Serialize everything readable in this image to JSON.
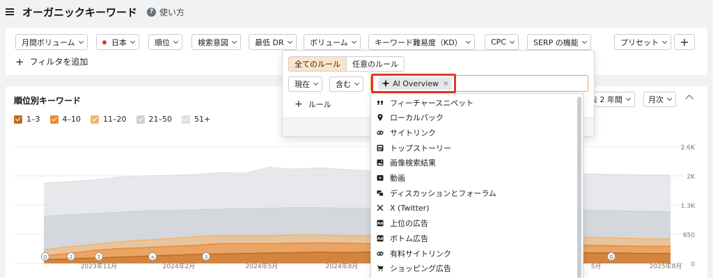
{
  "header": {
    "title": "オーガニックキーワード",
    "help_label": "使い方",
    "help_icon": "?"
  },
  "filters": {
    "buttons": [
      "月間ボリューム",
      "日本",
      "順位",
      "検索意図",
      "最低 DR",
      "ボリューム",
      "キーワード難易度（KD）",
      "CPC",
      "SERP の機能",
      "プリセット"
    ],
    "add_filter_label": "フィルタを追加",
    "plus_icon": "+"
  },
  "chart_card": {
    "title": "順位別キーワード",
    "legend": [
      {
        "label": "1–3",
        "color": "#c06c20",
        "checked": true
      },
      {
        "label": "4–10",
        "color": "#ed8a36",
        "checked": true
      },
      {
        "label": "11–20",
        "color": "#f5b46c",
        "checked": true
      },
      {
        "label": "21–50",
        "color": "#cdd1d6",
        "checked": true
      },
      {
        "label": "51+",
        "color": "#dde0e4",
        "checked": true
      }
    ],
    "period_label": "去 2 年間",
    "interval_label": "月次"
  },
  "chart_data": {
    "type": "area",
    "x_ticks": [
      "2023年11月",
      "2024年2月",
      "2024年5月",
      "2024年8月",
      "5月",
      "2025年8月"
    ],
    "y_ticks": [
      "2.6K",
      "2K",
      "1.3K",
      "650",
      "0"
    ],
    "ylim": [
      0,
      2600
    ],
    "grid": true,
    "series": [
      {
        "name": "1–3",
        "color": "#c06c20",
        "values": [
          80,
          100,
          120,
          140,
          160,
          180,
          200,
          210,
          220,
          230,
          240,
          250,
          240,
          250,
          250,
          260,
          260,
          260,
          260,
          250,
          240,
          240,
          230,
          230,
          220,
          220
        ]
      },
      {
        "name": "4–10",
        "color": "#ed8a36",
        "values": [
          170,
          220,
          290,
          330,
          350,
          380,
          400,
          440,
          440,
          440,
          450,
          460,
          450,
          440,
          440,
          440,
          450,
          450,
          440,
          430,
          420,
          410,
          400,
          390,
          380,
          380
        ]
      },
      {
        "name": "11–20",
        "color": "#f5b46c",
        "values": [
          300,
          370,
          420,
          480,
          520,
          550,
          590,
          620,
          620,
          620,
          630,
          630,
          620,
          620,
          630,
          620,
          630,
          620,
          620,
          610,
          600,
          590,
          580,
          560,
          550,
          540
        ]
      },
      {
        "name": "21–50",
        "color": "#cdd1d6",
        "values": [
          1050,
          1080,
          1110,
          1140,
          1170,
          1180,
          1190,
          1210,
          1220,
          1230,
          1240,
          1240,
          1230,
          1230,
          1240,
          1230,
          1240,
          1230,
          1230,
          1220,
          1200,
          1190,
          1180,
          1170,
          1160,
          1150
        ]
      },
      {
        "name": "51+",
        "color": "#dde0e4",
        "values": [
          1790,
          1820,
          1860,
          1920,
          1950,
          1960,
          1980,
          2020,
          2010,
          2140,
          2100,
          2130,
          2090,
          2060,
          2050,
          2030,
          2030,
          2010,
          1990,
          1980,
          1980,
          1990,
          1990,
          1980,
          1970,
          1970
        ]
      }
    ],
    "annotations": [
      "G",
      "2",
      "2",
      "a",
      "3",
      "G"
    ]
  },
  "popover": {
    "segment": [
      "全てのルール",
      "任意のルール"
    ],
    "condition_labels": [
      "現在",
      "含む"
    ],
    "tag_label": "AI Overview",
    "tag_close": "×",
    "add_rule_label": "ルール"
  },
  "dropdown": {
    "options": [
      {
        "label": "フィーチャースニペット",
        "icon": "quote-icon"
      },
      {
        "label": "ローカルパック",
        "icon": "map-pin-icon"
      },
      {
        "label": "サイトリンク",
        "icon": "link-icon"
      },
      {
        "label": "トップストーリー",
        "icon": "news-icon"
      },
      {
        "label": "画像検索結果",
        "icon": "image-icon"
      },
      {
        "label": "動画",
        "icon": "video-icon"
      },
      {
        "label": "ディスカッションとフォーラム",
        "icon": "chat-icon"
      },
      {
        "label": "X (Twitter)",
        "icon": "x-logo-icon"
      },
      {
        "label": "上位の広告",
        "icon": "ad-icon"
      },
      {
        "label": "ボトム広告",
        "icon": "ad-icon"
      },
      {
        "label": "有料サイトリンク",
        "icon": "link-icon"
      },
      {
        "label": "ショッピング広告",
        "icon": "cart-icon"
      }
    ]
  }
}
